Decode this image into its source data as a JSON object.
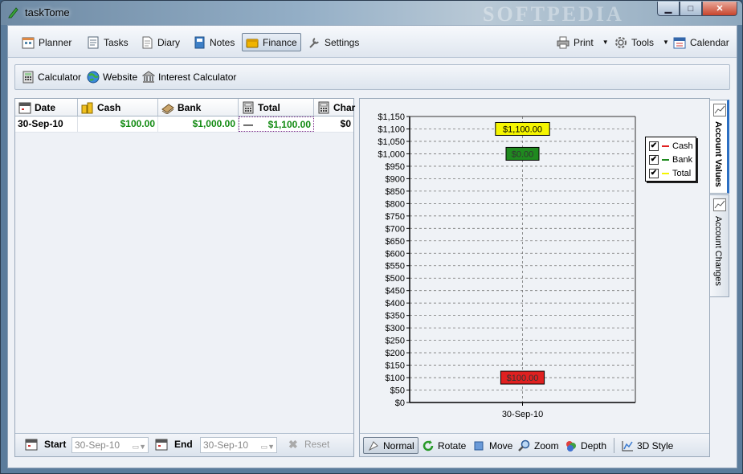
{
  "window": {
    "title": "taskTome",
    "watermark": "SOFTPEDIA",
    "controls": {
      "minimize": "▁",
      "maximize": "□",
      "close": "✕"
    }
  },
  "toolbar": {
    "items": [
      {
        "label": "Planner",
        "icon": "planner-icon",
        "active": false
      },
      {
        "label": "Tasks",
        "icon": "tasks-icon",
        "active": false
      },
      {
        "label": "Diary",
        "icon": "diary-icon",
        "active": false
      },
      {
        "label": "Notes",
        "icon": "notes-icon",
        "active": false
      },
      {
        "label": "Finance",
        "icon": "finance-icon",
        "active": true
      },
      {
        "label": "Settings",
        "icon": "settings-icon",
        "active": false
      }
    ],
    "right": [
      {
        "label": "Print",
        "icon": "printer-icon",
        "dropdown": true
      },
      {
        "label": "Tools",
        "icon": "gear-icon",
        "dropdown": true
      },
      {
        "label": "Calendar",
        "icon": "calendar-icon",
        "dropdown": false
      }
    ]
  },
  "subbar": {
    "items": [
      {
        "label": "Calculator",
        "icon": "calculator-icon"
      },
      {
        "label": "Website",
        "icon": "globe-icon"
      },
      {
        "label": "Interest Calculator",
        "icon": "bank-icon"
      }
    ]
  },
  "table": {
    "columns": [
      "Date",
      "Cash",
      "Bank",
      "Total",
      "Char"
    ],
    "rows": [
      {
        "date": "30-Sep-10",
        "cash": "$100.00",
        "bank": "$1,000.00",
        "total": "$1,100.00",
        "change": "$0"
      }
    ],
    "total_marker": "—"
  },
  "footer": {
    "start_label": "Start",
    "start_value": "30-Sep-10",
    "end_label": "End",
    "end_value": "30-Sep-10",
    "reset_label": "Reset"
  },
  "chart_data": {
    "type": "bar",
    "categories": [
      "30-Sep-10"
    ],
    "series": [
      {
        "name": "Cash",
        "values": [
          100
        ],
        "color": "#e02020",
        "label": "$100.00"
      },
      {
        "name": "Bank",
        "values": [
          1000
        ],
        "color": "#1f8a1f",
        "label": "$0.00"
      },
      {
        "name": "Total",
        "values": [
          1100
        ],
        "color": "#f5f500",
        "label": "$1,100.00"
      }
    ],
    "ylim": [
      0,
      1150
    ],
    "ytick_step": 50,
    "grid": true,
    "legend_position": "top-right"
  },
  "legend": {
    "items": [
      {
        "label": "Cash",
        "checked": true,
        "color": "#e02020"
      },
      {
        "label": "Bank",
        "checked": true,
        "color": "#1f8a1f"
      },
      {
        "label": "Total",
        "checked": true,
        "color": "#f5f500"
      }
    ],
    "check": "✔"
  },
  "chart_footer": {
    "items": [
      {
        "label": "Normal",
        "icon": "cursor-icon",
        "active": true
      },
      {
        "label": "Rotate",
        "icon": "rotate-icon",
        "active": false
      },
      {
        "label": "Move",
        "icon": "move-icon",
        "active": false
      },
      {
        "label": "Zoom",
        "icon": "zoom-icon",
        "active": false
      },
      {
        "label": "Depth",
        "icon": "depth-icon",
        "active": false
      },
      {
        "label": "3D Style",
        "icon": "chart-3d-icon",
        "active": false
      }
    ]
  },
  "side_tabs": [
    {
      "label": "Account Values",
      "active": true
    },
    {
      "label": "Account Changes",
      "active": false
    }
  ]
}
